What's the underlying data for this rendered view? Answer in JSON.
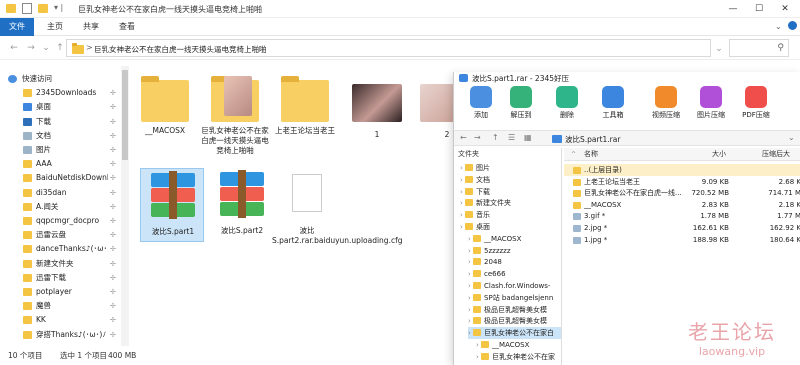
{
  "window": {
    "title": "巨乳女神老公不在家白虎一线天摸头逼电竞椅上啪啪"
  },
  "ribbon": {
    "tabs": [
      "文件",
      "主页",
      "共享",
      "查看"
    ]
  },
  "address": {
    "path": "巨乳女神老公不在家白虎一线天摸头逼电竞椅上啪啪",
    "chevron": ">"
  },
  "leftnav": {
    "items": [
      {
        "label": "快速访问",
        "icon": "star-icon",
        "pinned": false
      },
      {
        "label": "2345Downloads",
        "icon": "folder-icon",
        "pinned": true
      },
      {
        "label": "桌面",
        "icon": "desktop-icon",
        "pinned": true
      },
      {
        "label": "下载",
        "icon": "download-icon",
        "pinned": true
      },
      {
        "label": "文档",
        "icon": "document-icon",
        "pinned": true
      },
      {
        "label": "图片",
        "icon": "picture-icon",
        "pinned": true
      },
      {
        "label": "AAA",
        "icon": "folder-icon",
        "pinned": true
      },
      {
        "label": "BaiduNetdiskDownlo",
        "icon": "folder-icon",
        "pinned": true
      },
      {
        "label": "di35dan",
        "icon": "folder-icon",
        "pinned": true
      },
      {
        "label": "A.闻关",
        "icon": "folder-icon",
        "pinned": true
      },
      {
        "label": "qqpcmgr_docpro",
        "icon": "folder-icon",
        "pinned": true
      },
      {
        "label": "迅雷云盘",
        "icon": "folder-icon",
        "pinned": true
      },
      {
        "label": "danceThanks♪(･ω･)ﾉ",
        "icon": "folder-icon",
        "pinned": true
      },
      {
        "label": "新建文件夹",
        "icon": "folder-icon",
        "pinned": true
      },
      {
        "label": "迅雷下载",
        "icon": "folder-icon",
        "pinned": true
      },
      {
        "label": "potplayer",
        "icon": "folder-icon",
        "pinned": true
      },
      {
        "label": "魔兽",
        "icon": "folder-icon",
        "pinned": true
      },
      {
        "label": "KK",
        "icon": "folder-icon",
        "pinned": true
      },
      {
        "label": "穿搭Thanks♪(･ω･)ﾉ",
        "icon": "folder-icon",
        "pinned": true
      }
    ]
  },
  "files": [
    {
      "label": "__MACOSX",
      "kind": "folder"
    },
    {
      "label": "巨乳女神老公不在家白虎一线天摸头逼电竞椅上啪啪",
      "kind": "folder-thumb"
    },
    {
      "label": "上老王论坛当老王",
      "kind": "folder"
    },
    {
      "label": "1",
      "kind": "image"
    },
    {
      "label": "2",
      "kind": "image"
    },
    {
      "label": "波比S.part1",
      "kind": "rar"
    },
    {
      "label": "波比S.part2",
      "kind": "rar"
    },
    {
      "label": "波比S.part2.rar.baiduyun.uploading.cfg",
      "kind": "doc"
    }
  ],
  "status": {
    "count": "10 个项目",
    "selected": "选中 1 个项目",
    "size": "400 MB"
  },
  "zip": {
    "title": "波比S.part1.rar - 2345好压",
    "tools": [
      {
        "label": "添加",
        "color": "#4a8fe0"
      },
      {
        "label": "解压到",
        "color": "#35b27a"
      },
      {
        "label": "删除",
        "color": "#2fb58a"
      },
      {
        "label": "工具箱",
        "color": "#3d86e0"
      },
      {
        "label": "视频压缩",
        "color": "#f08a2a"
      },
      {
        "label": "图片压缩",
        "color": "#b04fd8"
      },
      {
        "label": "PDF压缩",
        "color": "#ef4e4a"
      }
    ],
    "path": "波比S.part1.rar",
    "tree_header": "文件夹",
    "tree": [
      {
        "label": "图片",
        "depth": 1
      },
      {
        "label": "文档",
        "depth": 1
      },
      {
        "label": "下载",
        "depth": 1
      },
      {
        "label": "新建文件夹",
        "depth": 1
      },
      {
        "label": "音乐",
        "depth": 1
      },
      {
        "label": "桌面",
        "depth": 1
      },
      {
        "label": "__MACOSX",
        "depth": 2
      },
      {
        "label": "5zzzzzz",
        "depth": 2
      },
      {
        "label": "2048",
        "depth": 2
      },
      {
        "label": "ce666",
        "depth": 2
      },
      {
        "label": "Clash.for.Windows-",
        "depth": 2
      },
      {
        "label": "SP站 badangelsjenn",
        "depth": 2
      },
      {
        "label": "极品巨乳超臀美女模",
        "depth": 2
      },
      {
        "label": "极品巨乳超臀美女模",
        "depth": 2
      },
      {
        "label": "巨乳女神老公不在家白",
        "depth": 2
      },
      {
        "label": "__MACOSX",
        "depth": 3
      },
      {
        "label": "巨乳女神老公不在家",
        "depth": 3
      }
    ],
    "columns": {
      "name": "名称",
      "size": "大小",
      "packed": "压缩后大"
    },
    "rows": [
      {
        "name": "..(上层目录)",
        "size": "",
        "packed": "",
        "kind": "folder"
      },
      {
        "name": "上老王论坛当老王",
        "size": "9.09 KB",
        "packed": "2.68 K",
        "kind": "folder"
      },
      {
        "name": "巨乳女神老公不在家白虎一线...",
        "size": "720.52 MB",
        "packed": "714.71 M",
        "kind": "folder"
      },
      {
        "name": "__MACOSX",
        "size": "2.83 KB",
        "packed": "2.18 K",
        "kind": "folder"
      },
      {
        "name": "3.gif *",
        "size": "1.78 MB",
        "packed": "1.77 M",
        "kind": "img"
      },
      {
        "name": "2.jpg *",
        "size": "162.61 KB",
        "packed": "162.92 K",
        "kind": "img"
      },
      {
        "name": "1.jpg *",
        "size": "188.98 KB",
        "packed": "180.64 K",
        "kind": "img"
      }
    ]
  },
  "watermark": {
    "line1": "老王论坛",
    "line2": "laowang.vip"
  }
}
